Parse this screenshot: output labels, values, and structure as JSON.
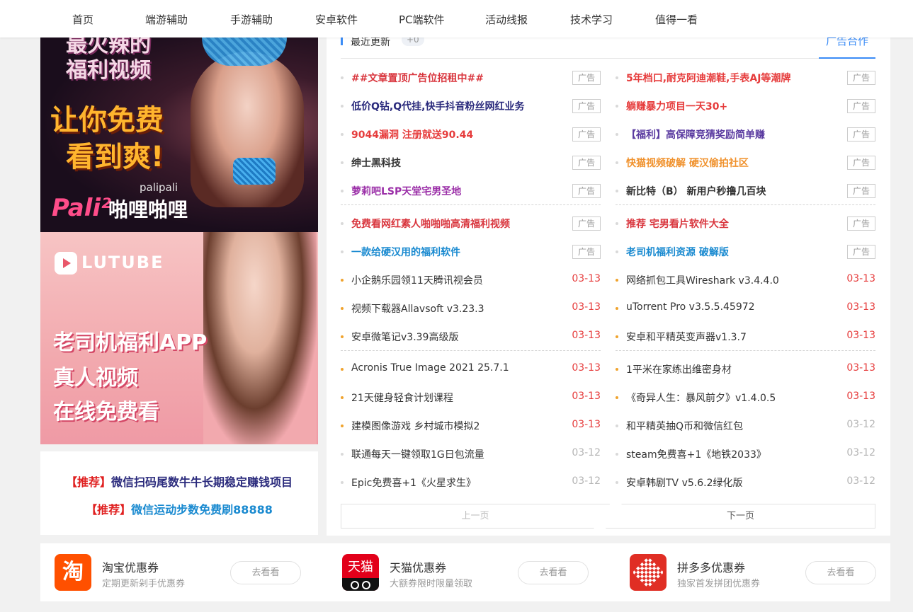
{
  "nav": [
    "首页",
    "端游辅助",
    "手游辅助",
    "安卓软件",
    "PC端软件",
    "活动线报",
    "技术学习",
    "值得一看"
  ],
  "banner1": {
    "line1": "最火辣的",
    "line2": "福利视频",
    "line3": "让你免费",
    "line4": "看到爽!",
    "sub": "palipali",
    "brand": "Pali²",
    "brand_cn": "啪哩啪哩"
  },
  "banner2": {
    "logo": "LUTUBE",
    "line1": "老司机福利APP",
    "line2": "真人视频",
    "line3": "在线免费看"
  },
  "recommend": [
    {
      "tag": "【推荐】",
      "text": "微信扫码尾数牛牛长期稳定赚钱项目"
    },
    {
      "tag": "【推荐】",
      "text": "微信运动步数免费刷88888"
    }
  ],
  "tabs": {
    "title": "最近更新",
    "badge": "+0",
    "ad_tab": "广告合作"
  },
  "ad_label": "广告",
  "left_ads": [
    {
      "title": "##文章置顶广告位招租中##",
      "color": "#d9363e"
    },
    {
      "title": "低价Q钻,Q代挂,快手抖音粉丝网红业务",
      "color": "#2a2a7c"
    },
    {
      "title": "9044漏洞 注册就送90.44",
      "color": "#e63c3c"
    },
    {
      "title": "绅士黑科技",
      "color": "#333333"
    },
    {
      "title": "萝莉吧LSP天堂宅男圣地",
      "color": "#9b2fa8"
    },
    {
      "title": "免费看网红素人啪啪啪高清福利视频",
      "color": "#d9363e"
    },
    {
      "title": "一款给硬汉用的福利软件",
      "color": "#1a8ad0"
    }
  ],
  "right_ads": [
    {
      "title": "5年档口,耐克阿迪潮鞋,手表AJ等潮牌",
      "color": "#e63c3c"
    },
    {
      "title": "躺赚暴力项目一天30+",
      "color": "#e63c3c"
    },
    {
      "title": "【福利】高保障竞猜奖励简单赚",
      "color": "#5a3aa0"
    },
    {
      "title": "快猫视频破解 硬汉偷拍社区",
      "color": "#f0922e"
    },
    {
      "title": "新比特（B） 新用户秒撸几百块",
      "color": "#333333"
    },
    {
      "title": "推荐 宅男看片软件大全",
      "color": "#d9363e"
    },
    {
      "title": "老司机福利资源 破解版",
      "color": "#1a8ad0"
    }
  ],
  "left_posts": [
    {
      "title": "小企鹅乐园领11天腾讯视会员",
      "date": "03-13",
      "is_new": true
    },
    {
      "title": "视频下载器Allavsoft v3.23.3",
      "date": "03-13",
      "is_new": true
    },
    {
      "title": "安卓微笔记v3.39高级版",
      "date": "03-13",
      "is_new": true
    },
    {
      "title": "Acronis True Image 2021 25.7.1",
      "date": "03-13",
      "is_new": true
    },
    {
      "title": "21天健身轻食计划课程",
      "date": "03-13",
      "is_new": true
    },
    {
      "title": "建模图像游戏 乡村城市模拟2",
      "date": "03-13",
      "is_new": true
    },
    {
      "title": "联通每天一键领取1G日包流量",
      "date": "03-12",
      "is_new": false
    },
    {
      "title": "Epic免费喜+1《火星求生》",
      "date": "03-12",
      "is_new": false
    }
  ],
  "right_posts": [
    {
      "title": "网络抓包工具Wireshark v3.4.4.0",
      "date": "03-13",
      "is_new": true
    },
    {
      "title": "uTorrent Pro v3.5.5.45972",
      "date": "03-13",
      "is_new": true
    },
    {
      "title": "安卓和平精英变声器v1.3.7",
      "date": "03-13",
      "is_new": true
    },
    {
      "title": "1平米在家练出维密身材",
      "date": "03-13",
      "is_new": true
    },
    {
      "title": "《奇异人生：暴风前夕》v1.4.0.5",
      "date": "03-13",
      "is_new": true
    },
    {
      "title": "和平精英抽Q币和微信红包",
      "date": "03-12",
      "is_new": false
    },
    {
      "title": "steam免费喜+1《地铁2033》",
      "date": "03-12",
      "is_new": false
    },
    {
      "title": "安卓韩剧TV v5.6.2绿化版",
      "date": "03-12",
      "is_new": false
    }
  ],
  "pager": {
    "prev": "上一页",
    "next": "下一页"
  },
  "coupons": [
    {
      "icon": "taobao-icon",
      "glyph": "淘",
      "title": "淘宝优惠券",
      "sub": "定期更新剁手优惠券",
      "button": "去看看"
    },
    {
      "icon": "tmall-icon",
      "glyph": "天猫",
      "title": "天猫优惠券",
      "sub": "大额券限时限量领取",
      "button": "去看看"
    },
    {
      "icon": "pinduoduo-icon",
      "glyph": "",
      "title": "拼多多优惠券",
      "sub": "独家首发拼团优惠券",
      "button": "去看看"
    }
  ],
  "colors": {
    "accent": "#3b8cf6",
    "new_date": "#e63c3c",
    "old_date": "#b5b5b5"
  }
}
